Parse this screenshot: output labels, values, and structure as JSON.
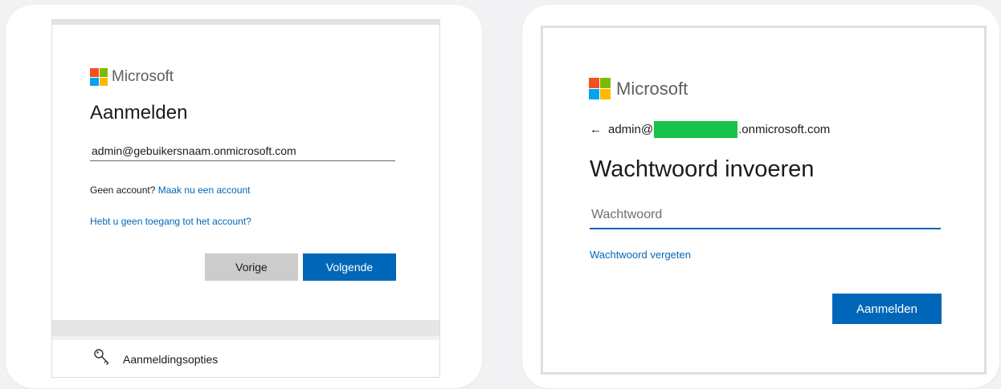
{
  "colors": {
    "ms_red": "#f25022",
    "ms_green": "#7fba00",
    "ms_blue": "#00a4ef",
    "ms_yellow": "#ffb900",
    "primary_button": "#0067b8",
    "secondary_button": "#cccccc",
    "link": "#0067b8",
    "redaction": "#17c24a"
  },
  "left": {
    "brand": "Microsoft",
    "title": "Aanmelden",
    "email_value": "admin@gebuikersnaam.onmicrosoft.com",
    "no_account_text": "Geen account?",
    "create_account_link": "Maak nu een account",
    "no_access_link": "Hebt u geen toegang tot het account?",
    "back_button": "Vorige",
    "next_button": "Volgende",
    "signin_options": "Aanmeldingsopties",
    "signin_options_icon": "key-icon"
  },
  "right": {
    "brand": "Microsoft",
    "back_icon": "arrow-left-icon",
    "identity_prefix": "admin@",
    "identity_suffix": ".onmicrosoft.com",
    "title": "Wachtwoord invoeren",
    "password_placeholder": "Wachtwoord",
    "forgot_link": "Wachtwoord vergeten",
    "signin_button": "Aanmelden"
  }
}
